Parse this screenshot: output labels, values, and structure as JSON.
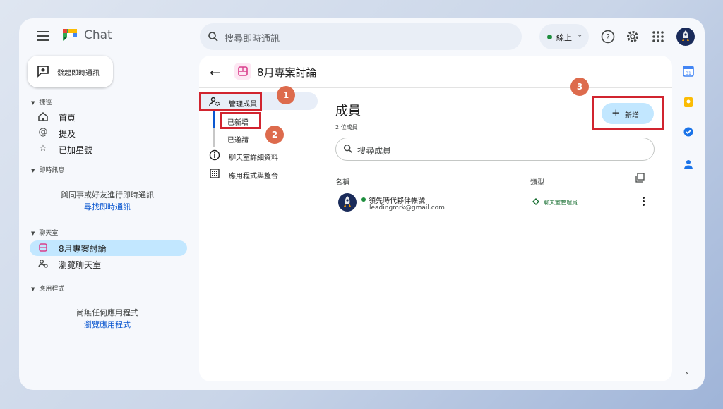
{
  "app": {
    "title": "Chat"
  },
  "search": {
    "placeholder": "搜尋即時通訊"
  },
  "status": {
    "label": "線上",
    "color": "#1e8e3e"
  },
  "sidebar": {
    "new_chat_label": "發起即時通訊",
    "shortcuts": {
      "heading": "捷徑",
      "items": [
        {
          "label": "首頁",
          "icon": "home-icon"
        },
        {
          "label": "提及",
          "icon": "at-icon"
        },
        {
          "label": "已加星號",
          "icon": "star-icon"
        }
      ]
    },
    "messages": {
      "heading": "即時訊息",
      "empty_text": "與同事或好友進行即時通訊",
      "empty_link": "尋找即時通訊"
    },
    "rooms": {
      "heading": "聊天室",
      "items": [
        {
          "label": "8月專案討論",
          "icon": "room-icon",
          "active": true
        },
        {
          "label": "瀏覽聊天室",
          "icon": "browse-rooms-icon"
        }
      ]
    },
    "apps": {
      "heading": "應用程式",
      "empty_text": "尚無任何應用程式",
      "empty_link": "瀏覽應用程式"
    }
  },
  "room": {
    "title": "8月專案討論",
    "subnav": {
      "manage_members": "管理成員",
      "added": "已新增",
      "invited": "已邀請",
      "room_details": "聊天室詳細資料",
      "apps_integrations": "應用程式與整合"
    },
    "members": {
      "title": "成員",
      "count": "2 位成員",
      "add_label": "新增",
      "search_placeholder": "搜尋成員",
      "columns": {
        "name": "名稱",
        "type": "類型"
      },
      "rows": [
        {
          "name": "領先時代夥伴帳號",
          "email": "leadingmrk@gmail.com",
          "role": "聊天室管理員",
          "online": true
        }
      ]
    }
  },
  "annotations": {
    "badges": [
      "1",
      "2",
      "3"
    ],
    "highlight_color": "#d1242f",
    "badge_color": "#dd6b4d"
  },
  "colors": {
    "accent": "#0b57d0",
    "active_bg": "#c2e7ff"
  }
}
